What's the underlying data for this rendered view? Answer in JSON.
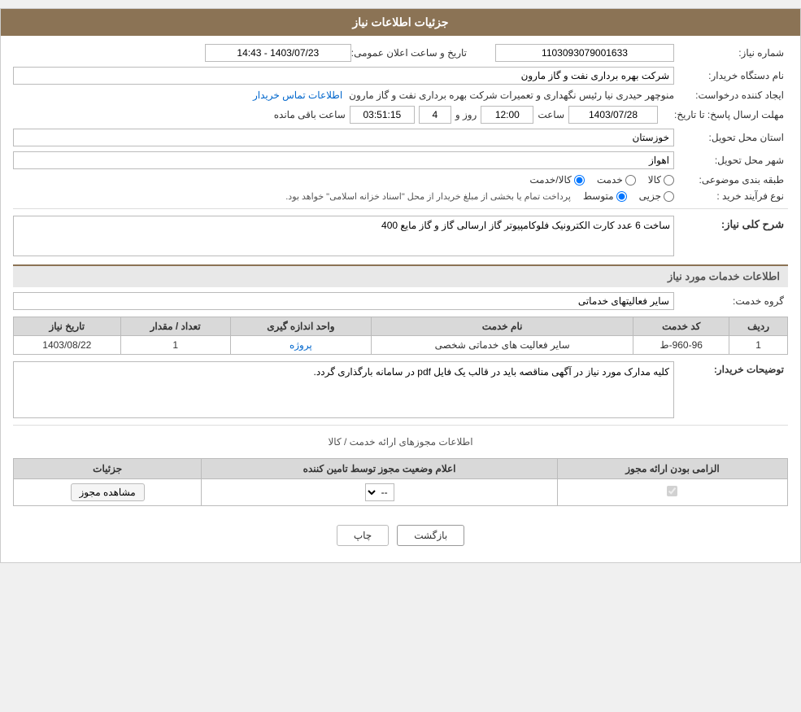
{
  "header": {
    "title": "جزئیات اطلاعات نیاز"
  },
  "form": {
    "shomara_niaz_label": "شماره نیاز:",
    "shomara_niaz_value": "1103093079001633",
    "name_dastgah_label": "نام دستگاه خریدار:",
    "name_dastgah_value": "شرکت بهره برداری نفت و گاز مارون",
    "ijad_label": "ایجاد کننده درخواست:",
    "ijad_value": "منوچهر حیدری نیا رئیس نگهداری و تعمیرات شرکت بهره برداری نفت و گاز مارون",
    "ijad_link": "اطلاعات تماس خریدار",
    "mohlat_label": "مهلت ارسال پاسخ: تا تاریخ:",
    "mohlat_date": "1403/07/28",
    "mohlat_saaat_label": "ساعت",
    "mohlat_saaat": "12:00",
    "mohlat_rooz_label": "روز و",
    "mohlat_rooz": "4",
    "mohlat_baqi_label": "ساعت باقی مانده",
    "mohlat_baqi": "03:51:15",
    "tarikh_label": "تاریخ و ساعت اعلان عمومی:",
    "tarikh_value": "1403/07/23 - 14:43",
    "ostan_label": "استان محل تحویل:",
    "ostan_value": "خوزستان",
    "shahr_label": "شهر محل تحویل:",
    "shahr_value": "اهواز",
    "tabaqe_label": "طبقه بندی موضوعی:",
    "radio_kala": "کالا",
    "radio_khedmat": "خدمت",
    "radio_kala_khedmat": "کالا/خدمت",
    "nooe_farayand_label": "نوع فرآیند خرید :",
    "radio_jozii": "جزیی",
    "radio_mootasat": "متوسط",
    "nooe_farayand_desc": "پرداخت تمام یا بخشی از مبلغ خریدار از محل \"اسناد خزانه اسلامی\" خواهد بود.",
    "sharh_koli_label": "شرح کلی نیاز:",
    "sharh_koli_value": "ساخت 6 عدد کارت الکترونیک فلوکامپیوتر گاز ارسالی گاز و گاز مایع 400",
    "khedamat_section": "اطلاعات خدمات مورد نیاز",
    "grooh_khedmat_label": "گروه خدمت:",
    "grooh_khedmat_value": "سایر فعالیتهای خدماتی",
    "table_headers": [
      "ردیف",
      "کد خدمت",
      "نام خدمت",
      "واحد اندازه گیری",
      "تعداد / مقدار",
      "تاریخ نیاز"
    ],
    "table_rows": [
      {
        "radif": "1",
        "kod": "960-96-ط",
        "name": "سایر فعالیت های خدماتی شخصی",
        "vahed": "پروژه",
        "tedad": "1",
        "tarikh": "1403/08/22"
      }
    ],
    "toozihat_label": "توضیحات خریدار:",
    "toozihat_value": "کلیه مدارک مورد نیاز در آگهی مناقصه باید در قالب یک فایل pdf در سامانه بارگذاری گردد.",
    "mojavez_section": "اطلاعات مجوزهای ارائه خدمت / کالا",
    "mojavez_table_headers": [
      "الزامی بودن ارائه مجوز",
      "اعلام وضعیت مجوز توسط تامین کننده",
      "جزئیات"
    ],
    "mojavez_rows": [
      {
        "elzami": "✓",
        "eelam": "--",
        "joziat": "مشاهده مجوز"
      }
    ],
    "btn_chap": "چاپ",
    "btn_bazgasht": "بازگشت"
  }
}
